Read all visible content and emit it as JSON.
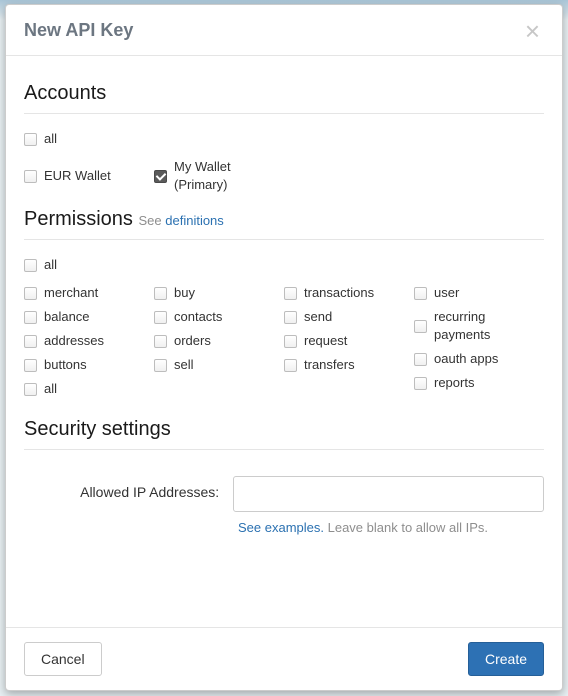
{
  "modal": {
    "title": "New API Key"
  },
  "accounts": {
    "heading": "Accounts",
    "all_label": "all",
    "items": [
      {
        "label": "EUR Wallet",
        "checked": false
      },
      {
        "label": "My Wallet (Primary)",
        "checked": true
      }
    ]
  },
  "permissions": {
    "heading": "Permissions",
    "see_label": "See",
    "definitions_link": "definitions",
    "all_label": "all",
    "columns": [
      [
        "merchant",
        "balance",
        "addresses",
        "buttons",
        "all"
      ],
      [
        "buy",
        "contacts",
        "orders",
        "sell"
      ],
      [
        "transactions",
        "send",
        "request",
        "transfers"
      ],
      [
        "user",
        "recurring payments",
        "oauth apps",
        "reports"
      ]
    ]
  },
  "security": {
    "heading": "Security settings",
    "ip_label": "Allowed IP Addresses:",
    "ip_value": "",
    "see_examples": "See examples.",
    "help_rest": " Leave blank to allow all IPs."
  },
  "footer": {
    "cancel": "Cancel",
    "create": "Create"
  }
}
